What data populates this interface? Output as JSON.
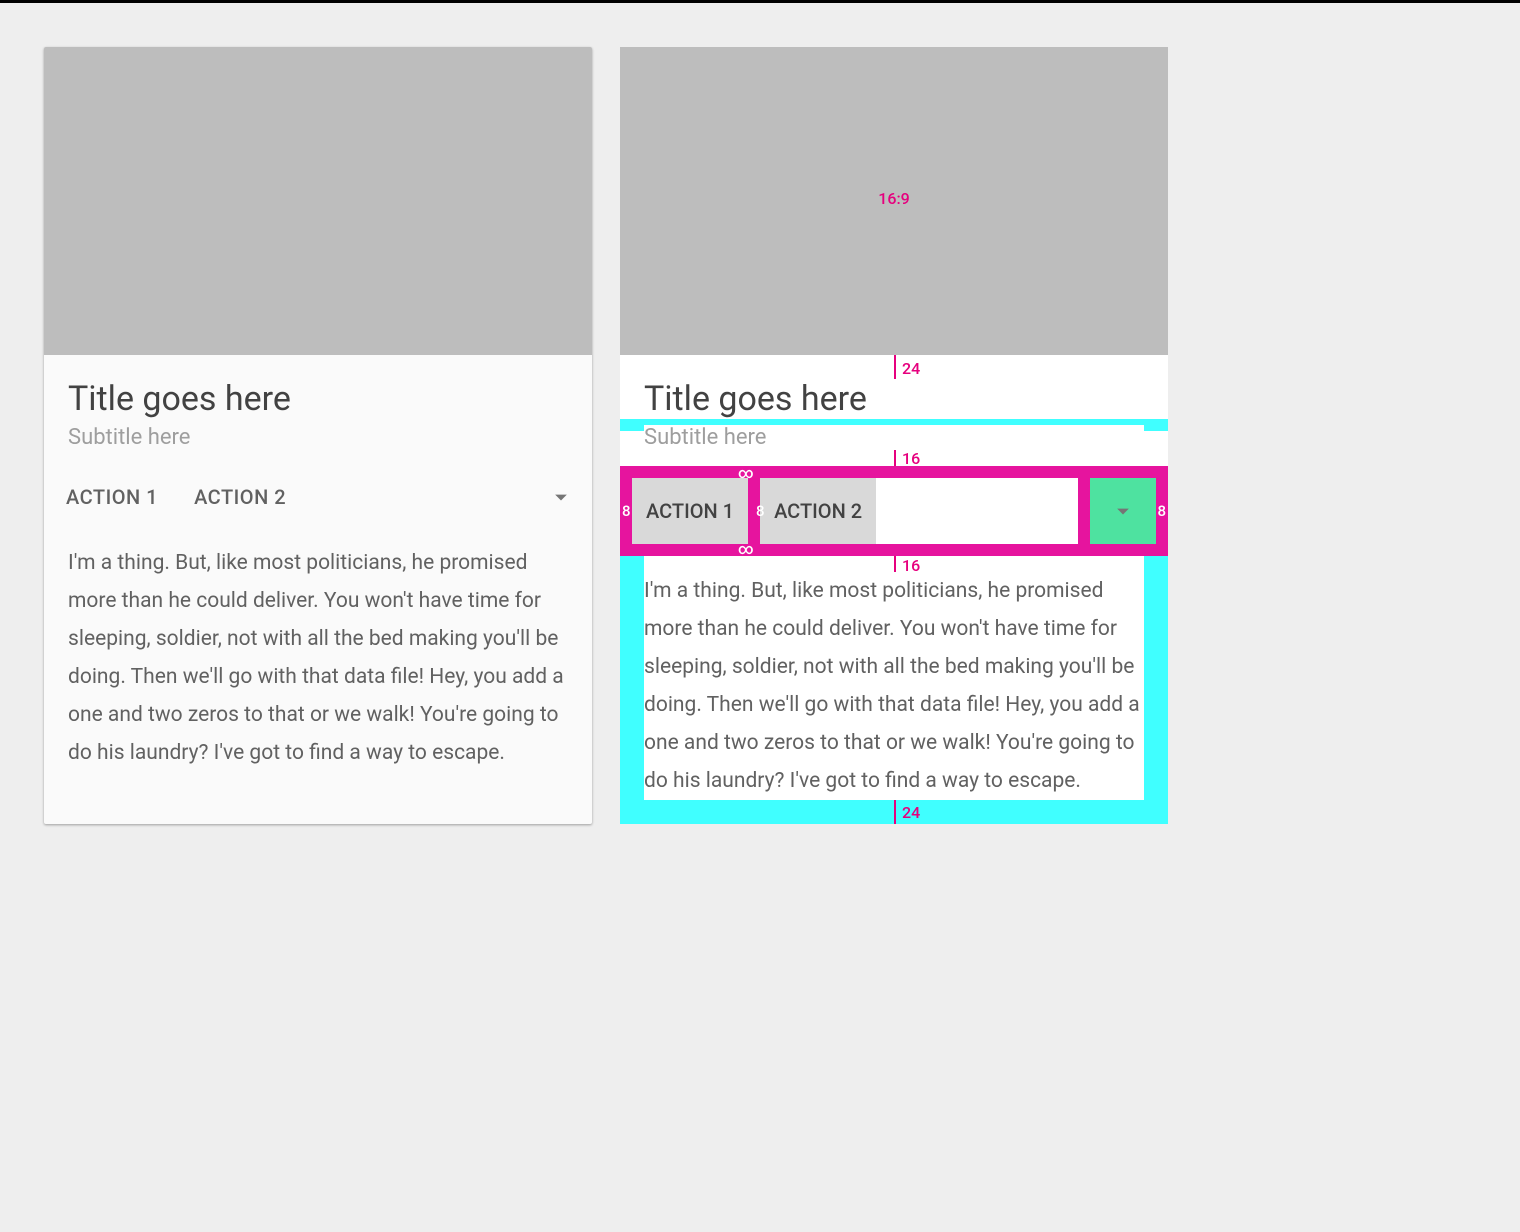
{
  "card": {
    "title": "Title goes here",
    "subtitle": "Subtitle here",
    "action1": "ACTION 1",
    "action2": "ACTION 2",
    "body": "I'm a thing. But, like most politicians, he promised more than he could deliver. You won't have time for sleeping, soldier, not with all the bed making you'll be doing. Then we'll go with that data file! Hey, you add a one and two zeros to that or we walk! You're going to do his laundry? I've got to find a way to escape."
  },
  "spec": {
    "aspect": "16:9",
    "m_top": "24",
    "m_mid": "16",
    "m_body_top": "16",
    "m_bottom": "24",
    "pad8": "8",
    "inf": "∞"
  }
}
